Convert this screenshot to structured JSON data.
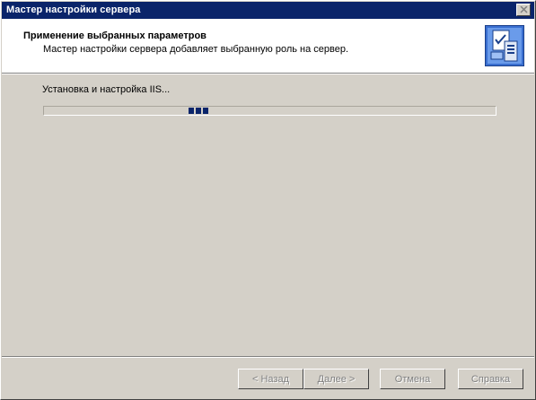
{
  "window": {
    "title": "Мастер настройки сервера"
  },
  "header": {
    "title": "Применение выбранных параметров",
    "subtitle": "Мастер настройки сервера добавляет выбранную роль на сервер."
  },
  "main": {
    "status": "Установка и настройка IIS...",
    "progress": {
      "style": "marquee"
    }
  },
  "buttons": {
    "back": "< Назад",
    "next": "Далее >",
    "cancel": "Отмена",
    "help": "Справка"
  },
  "colors": {
    "titlebar": "#0a246a",
    "face": "#d4d0c8",
    "progress_block": "#0a246a"
  },
  "icons": {
    "close": "close-icon",
    "wizard": "server-checklist-icon"
  }
}
